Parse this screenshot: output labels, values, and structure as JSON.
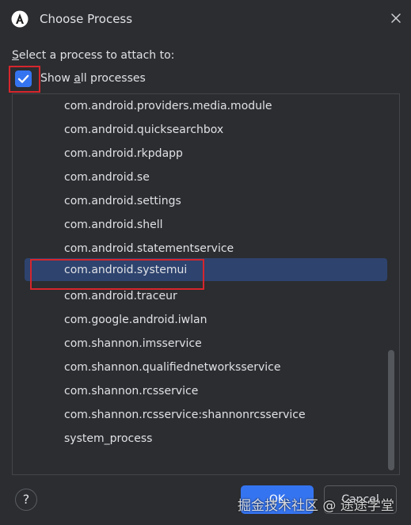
{
  "window": {
    "title": "Choose Process"
  },
  "prompt": {
    "prefix": "S",
    "rest": "elect a process to attach to:"
  },
  "show_all": {
    "label_prefix": "Show ",
    "label_underline": "a",
    "label_rest": "ll processes",
    "checked": true
  },
  "processes": [
    "com.android.providers.media.module",
    "com.android.quicksearchbox",
    "com.android.rkpdapp",
    "com.android.se",
    "com.android.settings",
    "com.android.shell",
    "com.android.statementservice",
    "com.android.systemui",
    "com.android.traceur",
    "com.google.android.iwlan",
    "com.shannon.imsservice",
    "com.shannon.qualifiednetworksservice",
    "com.shannon.rcsservice",
    "com.shannon.rcsservice:shannonrcsservice",
    "system_process"
  ],
  "selected_process": "com.android.systemui",
  "buttons": {
    "help": "?",
    "ok": "OK",
    "cancel": "Cancel"
  },
  "watermark": "掘金技术社区 @ 途途学堂",
  "colors": {
    "accent": "#3574f0",
    "selection": "#2e436e",
    "highlight": "#d6262c",
    "background": "#2b2d30"
  }
}
